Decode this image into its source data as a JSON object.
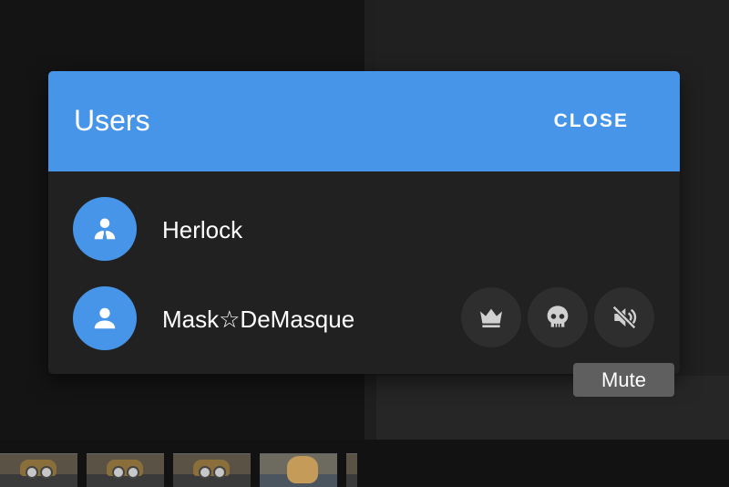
{
  "dialog": {
    "title": "Users",
    "close_label": "CLOSE"
  },
  "users": [
    {
      "name": "Herlock",
      "avatar_icon": "user-tie-icon",
      "actions": []
    },
    {
      "name": "Mask☆DeMasque",
      "avatar_icon": "user-icon",
      "actions": [
        "crown-icon",
        "skull-icon",
        "volume-off-icon"
      ]
    }
  ],
  "tooltip": {
    "text": "Mute"
  },
  "colors": {
    "accent": "#4795e8",
    "dialog_bg": "#212121",
    "action_bg": "#2e2e2e",
    "icon_grey": "#d0d0d0",
    "tooltip_bg": "#5f5f5f"
  }
}
